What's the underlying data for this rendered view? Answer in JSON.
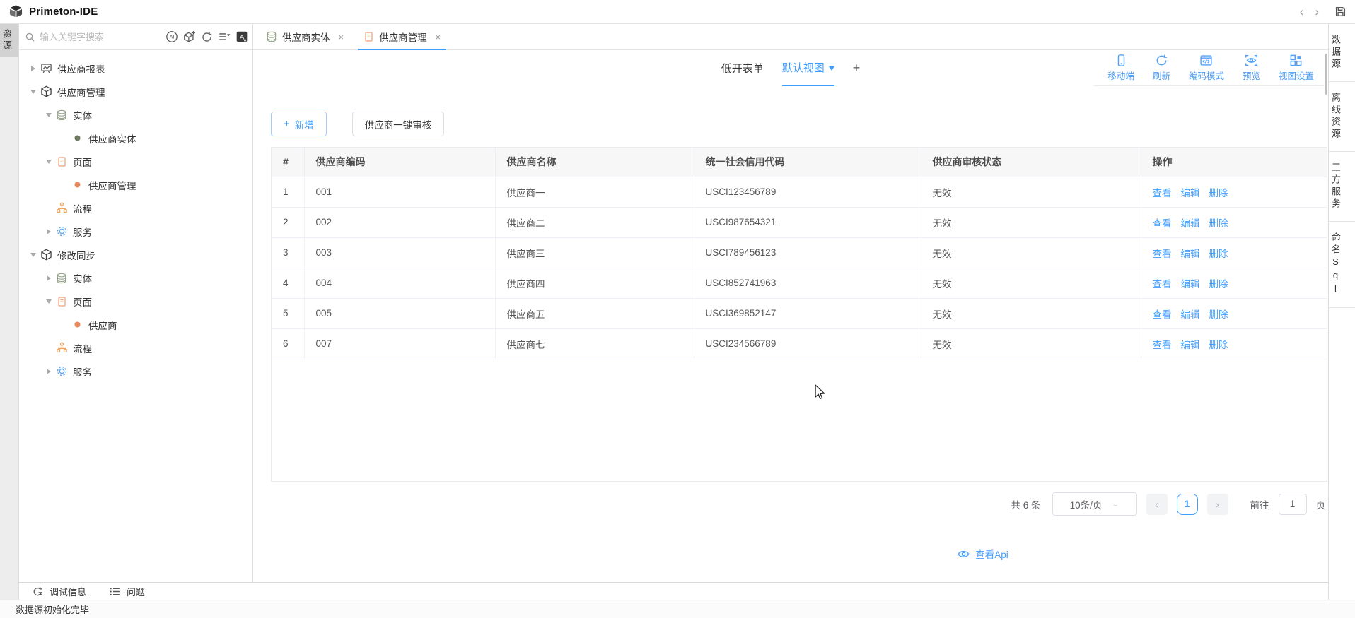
{
  "app": {
    "title": "Primeton-IDE",
    "status_bar": "数据源初始化完毕"
  },
  "left_rail": {
    "label": "资源"
  },
  "sidebar": {
    "search": {
      "placeholder": "输入关键字搜索"
    },
    "tools": [
      "ai",
      "new-module",
      "refresh",
      "sort-list",
      "translate"
    ],
    "tree": [
      {
        "depth": 0,
        "arrow": "right",
        "icon": "report",
        "label": "供应商报表"
      },
      {
        "depth": 0,
        "arrow": "down",
        "icon": "module",
        "label": "供应商管理"
      },
      {
        "depth": 1,
        "arrow": "down",
        "icon": "entity",
        "label": "实体"
      },
      {
        "depth": 2,
        "arrow": "none",
        "icon": "dot-green",
        "label": "供应商实体"
      },
      {
        "depth": 1,
        "arrow": "down",
        "icon": "page",
        "label": "页面"
      },
      {
        "depth": 2,
        "arrow": "none",
        "icon": "dot-orange",
        "label": "供应商管理"
      },
      {
        "depth": 1,
        "arrow": "none",
        "icon": "flow",
        "label": "流程"
      },
      {
        "depth": 1,
        "arrow": "right",
        "icon": "service",
        "label": "服务"
      },
      {
        "depth": 0,
        "arrow": "down",
        "icon": "module",
        "label": "修改同步"
      },
      {
        "depth": 1,
        "arrow": "right",
        "icon": "entity",
        "label": "实体"
      },
      {
        "depth": 1,
        "arrow": "down",
        "icon": "page",
        "label": "页面"
      },
      {
        "depth": 2,
        "arrow": "none",
        "icon": "dot-orange",
        "label": "供应商"
      },
      {
        "depth": 1,
        "arrow": "none",
        "icon": "flow",
        "label": "流程"
      },
      {
        "depth": 1,
        "arrow": "right",
        "icon": "service",
        "label": "服务"
      }
    ]
  },
  "editor_tabs": [
    {
      "icon": "entity",
      "label": "供应商实体",
      "active": false
    },
    {
      "icon": "page",
      "label": "供应商管理",
      "active": true
    }
  ],
  "view_header": {
    "form_name": "低开表单",
    "view_name": "默认视图",
    "add_tab": "+",
    "actions": [
      {
        "icon": "mobile",
        "label": "移动端"
      },
      {
        "icon": "refresh-blue",
        "label": "刷新"
      },
      {
        "icon": "code",
        "label": "编码模式"
      },
      {
        "icon": "preview",
        "label": "预览"
      },
      {
        "icon": "grid",
        "label": "视图设置"
      }
    ]
  },
  "actions_bar": {
    "add": "新增",
    "audit": "供应商一键审核"
  },
  "table": {
    "columns": [
      "#",
      "供应商编码",
      "供应商名称",
      "统一社会信用代码",
      "供应商审核状态",
      "操作"
    ],
    "rows": [
      {
        "index": "1",
        "code": "001",
        "name": "供应商一",
        "usci": "USCI123456789",
        "status": "无效"
      },
      {
        "index": "2",
        "code": "002",
        "name": "供应商二",
        "usci": "USCI987654321",
        "status": "无效"
      },
      {
        "index": "3",
        "code": "003",
        "name": "供应商三",
        "usci": "USCI789456123",
        "status": "无效"
      },
      {
        "index": "4",
        "code": "004",
        "name": "供应商四",
        "usci": "USCI852741963",
        "status": "无效"
      },
      {
        "index": "5",
        "code": "005",
        "name": "供应商五",
        "usci": "USCI369852147",
        "status": "无效"
      },
      {
        "index": "6",
        "code": "007",
        "name": "供应商七",
        "usci": "USCI234566789",
        "status": "无效"
      }
    ],
    "row_actions": [
      "查看",
      "编辑",
      "删除"
    ]
  },
  "pagination": {
    "total": "共 6 条",
    "page_size": "10条/页",
    "current_page": "1",
    "goto_label": "前往",
    "goto_value": "1",
    "page_unit": "页"
  },
  "api_link": {
    "label": "查看Api"
  },
  "right_rail": {
    "items": [
      "数据源",
      "离线资源",
      "三方服务",
      "命名Sql"
    ]
  },
  "bottom_panel": {
    "items": [
      {
        "icon": "debug",
        "label": "调试信息"
      },
      {
        "icon": "problems",
        "label": "问题"
      }
    ]
  },
  "colors": {
    "accent": "#409eff",
    "link": "#409eff"
  }
}
